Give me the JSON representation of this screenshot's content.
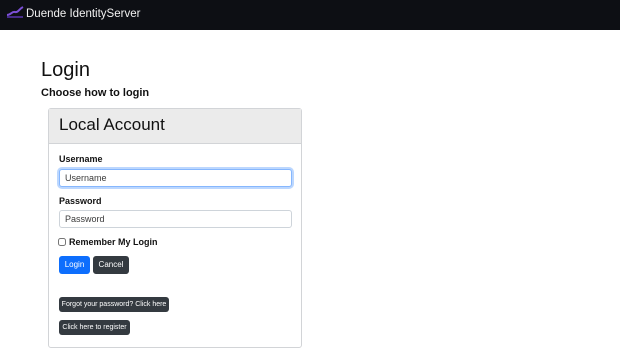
{
  "navbar": {
    "brand": "Duende IdentityServer",
    "brand_color": "#6f42c1"
  },
  "page": {
    "title": "Login",
    "subtitle": "Choose how to login"
  },
  "local_account": {
    "header": "Local Account",
    "username_label": "Username",
    "username_placeholder": "Username",
    "password_label": "Password",
    "password_placeholder": "Password",
    "remember_label": "Remember My Login",
    "remember_checked": false,
    "login_button": "Login",
    "cancel_button": "Cancel",
    "forgot_password_button": "Forgot your password? Click here",
    "register_button": "Click here to register"
  },
  "colors": {
    "primary": "#0d6efd",
    "dark": "#343a40",
    "navbar": "#0d0f14"
  }
}
